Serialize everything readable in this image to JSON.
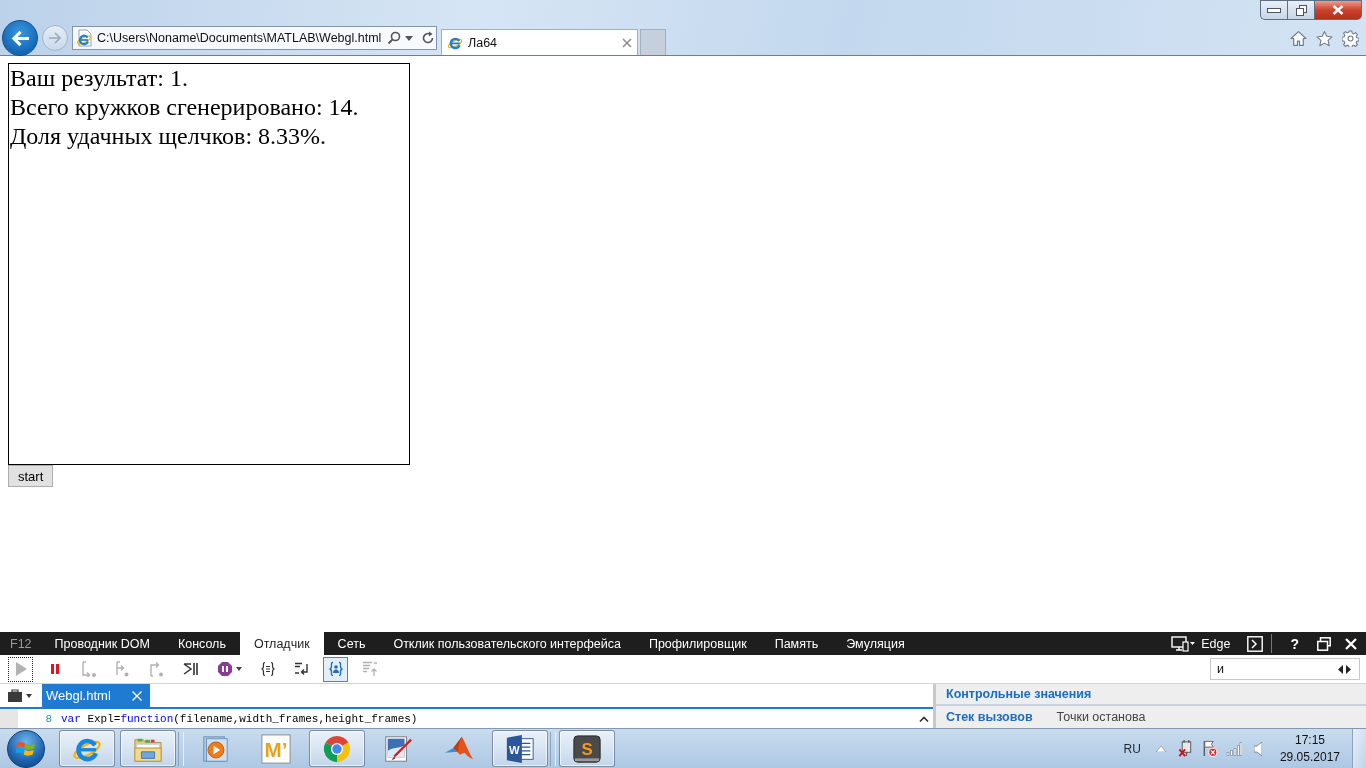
{
  "browser": {
    "address": "C:\\Users\\Noname\\Documents\\MATLAB\\Webgl.html",
    "tabs": [
      {
        "title": "Ла64",
        "selected": true
      }
    ]
  },
  "page": {
    "canvas_lines": [
      "Ваш результат: 1.",
      "Всего кружков сгенерировано: 14.",
      "Доля удачных щелчков: 8.33%."
    ],
    "start_button": "start"
  },
  "devtools": {
    "f12_label": "F12",
    "tabs": [
      {
        "label": "Проводник DOM",
        "selected": false
      },
      {
        "label": "Консоль",
        "selected": false
      },
      {
        "label": "Отладчик",
        "selected": true
      },
      {
        "label": "Сеть",
        "selected": false
      },
      {
        "label": "Отклик пользовательского интерфейса",
        "selected": false
      },
      {
        "label": "Профилировщик",
        "selected": false
      },
      {
        "label": "Память",
        "selected": false
      },
      {
        "label": "Эмуляция",
        "selected": false
      }
    ],
    "mode": "Edge",
    "help": "?",
    "toolbar": [
      {
        "kind": "continue",
        "disabled": true,
        "on": false,
        "focused": true
      },
      {
        "kind": "break",
        "disabled": false,
        "on": false,
        "focused": false
      },
      {
        "kind": "step-into",
        "disabled": true,
        "on": false,
        "focused": false
      },
      {
        "kind": "step-over",
        "disabled": true,
        "on": false,
        "focused": false
      },
      {
        "kind": "step-out",
        "disabled": true,
        "on": false,
        "focused": false
      },
      {
        "kind": "break-worker",
        "disabled": false,
        "on": false,
        "focused": false
      },
      {
        "kind": "exceptions",
        "disabled": false,
        "on": false,
        "focused": false
      },
      {
        "kind": "pretty-print",
        "disabled": false,
        "on": false,
        "focused": false
      },
      {
        "kind": "word-wrap",
        "disabled": false,
        "on": false,
        "focused": false
      },
      {
        "kind": "just-my-code",
        "disabled": false,
        "on": true,
        "focused": false
      },
      {
        "kind": "source-map",
        "disabled": true,
        "on": false,
        "focused": false
      }
    ],
    "search": {
      "value": "и"
    },
    "files": [
      {
        "name": "Webgl.html",
        "selected": true
      }
    ],
    "code": {
      "line_number": "8",
      "tokens": [
        {
          "text": "var",
          "kind": "keyword"
        },
        {
          "text": " Expl=",
          "kind": "plain"
        },
        {
          "text": "function",
          "kind": "keyword"
        },
        {
          "text": "(filename,width_frames,height_frames)",
          "kind": "plain"
        }
      ]
    },
    "watches_title": "Контрольные значения",
    "panel_tabs": [
      {
        "label": "Стек вызовов",
        "selected": true
      },
      {
        "label": "Точки останова",
        "selected": false
      }
    ]
  },
  "taskbar": {
    "groups": [
      {
        "apps": [
          {
            "kind": "browser",
            "running": true
          },
          {
            "kind": "explorer",
            "running": true
          }
        ]
      },
      {
        "apps": [
          {
            "kind": "media",
            "running": false
          },
          {
            "kind": "letter-tile",
            "glyph": "M’",
            "running": false
          },
          {
            "kind": "chrome",
            "running": true
          },
          {
            "kind": "paint",
            "running": false
          },
          {
            "kind": "matlab",
            "running": false
          },
          {
            "kind": "word",
            "glyph": "W",
            "running": true
          }
        ]
      },
      {
        "apps": [
          {
            "kind": "sublime",
            "glyph": "S",
            "running": true
          }
        ]
      }
    ],
    "language": "RU",
    "time": "17:15",
    "date": "29.05.2017"
  }
}
